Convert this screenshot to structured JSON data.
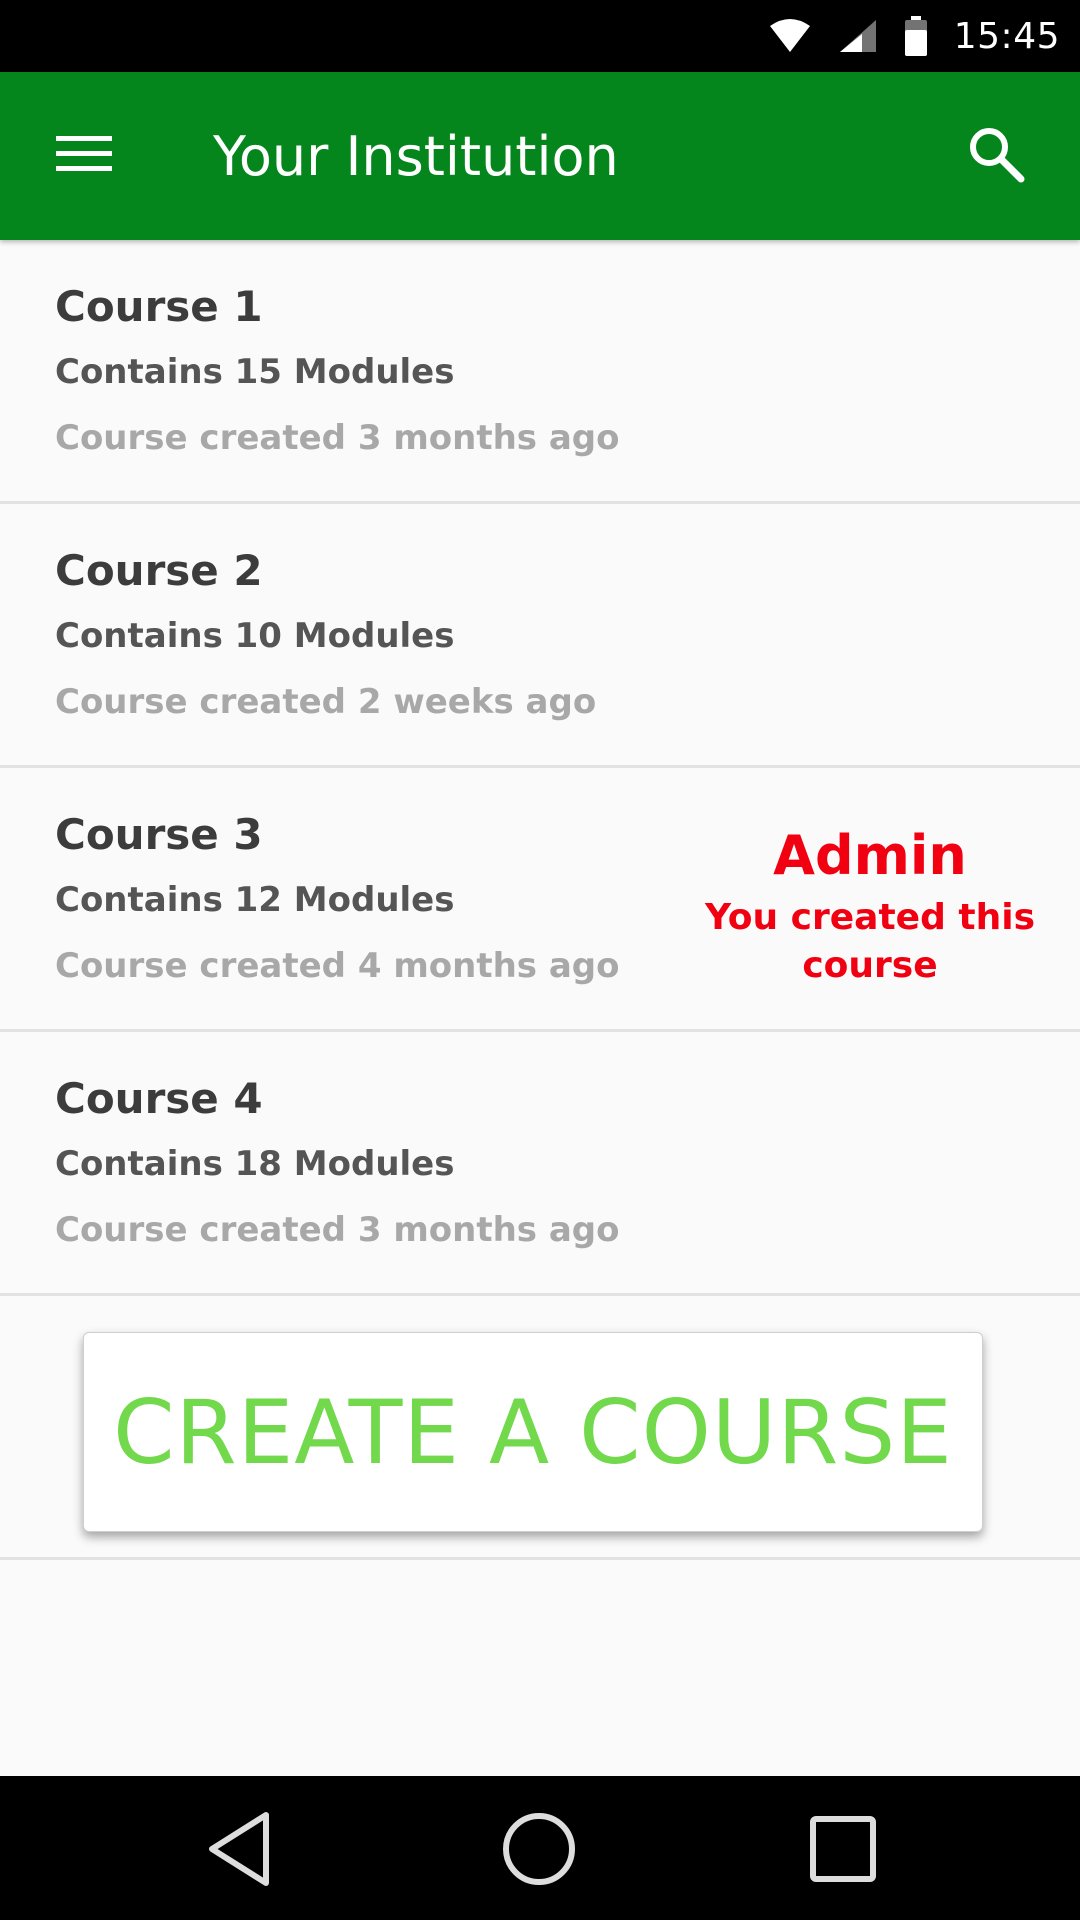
{
  "status_bar": {
    "time": "15:45",
    "icons": [
      "wifi-icon",
      "cell-signal-icon",
      "battery-icon"
    ]
  },
  "app_bar": {
    "title": "Your Institution",
    "menu_icon": "menu-icon",
    "search_icon": "search-icon",
    "background_color": "#05861c"
  },
  "courses": [
    {
      "name": "Course 1",
      "modules": "Contains 15 Modules",
      "created": "Course created 3 months ago"
    },
    {
      "name": "Course 2",
      "modules": "Contains 10 Modules",
      "created": "Course created 2 weeks ago"
    },
    {
      "name": "Course 3",
      "modules": "Contains 12 Modules",
      "created": "Course created 4 months ago",
      "admin": {
        "title": "Admin",
        "note": "You created this course"
      }
    },
    {
      "name": "Course 4",
      "modules": "Contains 18 Modules",
      "created": "Course created 3 months ago"
    }
  ],
  "create_button": {
    "label": "CREATE A COURSE",
    "text_color": "#72d84c"
  },
  "admin_color": "#f00010",
  "nav_bar": {
    "icons": [
      "back-icon",
      "home-icon",
      "recent-apps-icon"
    ]
  }
}
